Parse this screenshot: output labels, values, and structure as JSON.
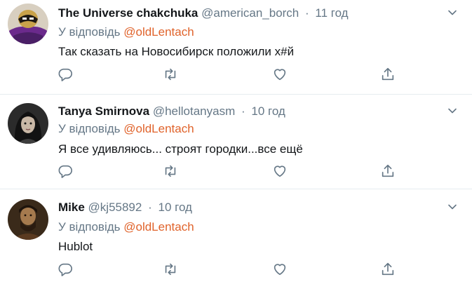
{
  "reply_prefix": "У відповідь",
  "colors": {
    "mention": "#e0632b",
    "secondary_text": "#657786",
    "primary_text": "#14171a",
    "divider": "#e6ecf0"
  },
  "icons": {
    "reply": "reply-icon",
    "retweet": "retweet-icon",
    "like": "like-icon",
    "share": "share-icon",
    "more": "chevron-down-icon"
  },
  "tweets": [
    {
      "display_name": "The Universe chakchuka",
      "handle": "@american_borch",
      "separator": "·",
      "time": "11 год",
      "reply_to": "@oldLentach",
      "text": "Так сказать на Новосибирск положили х#й"
    },
    {
      "display_name": "Tanya Smirnova",
      "handle": "@hellotanyasm",
      "separator": "·",
      "time": "10 год",
      "reply_to": "@oldLentach",
      "text": "Я все удивляюсь... строят городки...все ещё"
    },
    {
      "display_name": "Mike",
      "handle": "@kj55892",
      "separator": "·",
      "time": "10 год",
      "reply_to": "@oldLentach",
      "text": "Hublot"
    }
  ]
}
